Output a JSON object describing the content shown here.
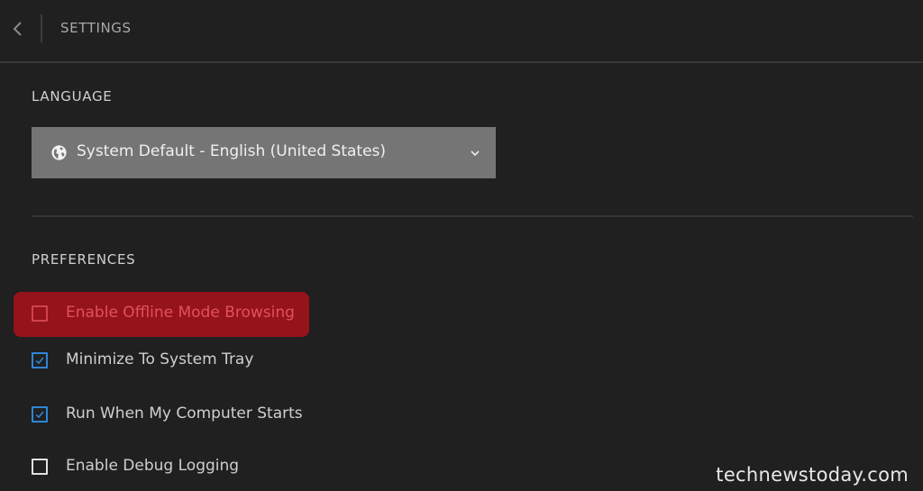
{
  "header": {
    "title": "SETTINGS"
  },
  "language": {
    "section_title": "LANGUAGE",
    "selected_value": "System Default - English (United States)"
  },
  "preferences": {
    "section_title": "PREFERENCES",
    "items": [
      {
        "label": "Enable Offline Mode Browsing",
        "checked": false,
        "highlighted": true
      },
      {
        "label": "Minimize To System Tray",
        "checked": true,
        "highlighted": false
      },
      {
        "label": "Run When My Computer Starts",
        "checked": true,
        "highlighted": false
      },
      {
        "label": "Enable Debug Logging",
        "checked": false,
        "highlighted": false
      }
    ]
  },
  "colors": {
    "background": "#202020",
    "select_background": "#757575",
    "checkbox_checked": "#2f86d6",
    "highlight": "#a5111a"
  },
  "watermark": "technewstoday.com"
}
